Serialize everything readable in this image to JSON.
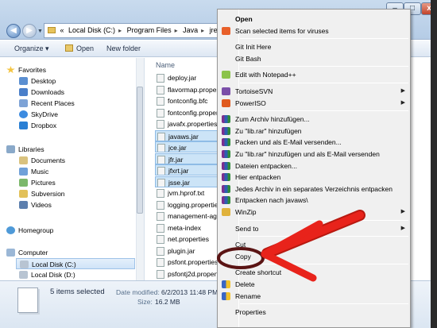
{
  "address": {
    "path": [
      "«",
      "Local Disk (C:)",
      "Program Files",
      "Java",
      "jre7"
    ]
  },
  "window_buttons": {
    "minimize": "–",
    "maximize": "□",
    "close": "x"
  },
  "toolbar": {
    "organize": "Organize ▾",
    "open": "Open",
    "new_folder": "New folder"
  },
  "navpane": {
    "favorites_header": "Favorites",
    "favorites": [
      "Desktop",
      "Downloads",
      "Recent Places",
      "SkyDrive",
      "Dropbox"
    ],
    "libraries_header": "Libraries",
    "libraries": [
      "Documents",
      "Music",
      "Pictures",
      "Subversion",
      "Videos"
    ],
    "homegroup": "Homegroup",
    "computer_header": "Computer",
    "drives": [
      "Local Disk (C:)",
      "Local Disk (D:)"
    ]
  },
  "filelist": {
    "column_name": "Name",
    "files": [
      {
        "name": "deploy.jar",
        "selected": false
      },
      {
        "name": "flavormap.properties",
        "selected": false
      },
      {
        "name": "fontconfig.bfc",
        "selected": false
      },
      {
        "name": "fontconfig.properties.src",
        "selected": false
      },
      {
        "name": "javafx.properties",
        "selected": false
      },
      {
        "name": "javaws.jar",
        "selected": true
      },
      {
        "name": "jce.jar",
        "selected": true
      },
      {
        "name": "jfr.jar",
        "selected": true
      },
      {
        "name": "jfxrt.jar",
        "selected": true
      },
      {
        "name": "jsse.jar",
        "selected": true
      },
      {
        "name": "jvm.hprof.txt",
        "selected": false
      },
      {
        "name": "logging.properties",
        "selected": false
      },
      {
        "name": "management-agent.jar",
        "selected": false
      },
      {
        "name": "meta-index",
        "selected": false
      },
      {
        "name": "net.properties",
        "selected": false
      },
      {
        "name": "plugin.jar",
        "selected": false
      },
      {
        "name": "psfont.properties.ja",
        "selected": false
      },
      {
        "name": "psfontj2d.properties",
        "selected": false
      }
    ]
  },
  "details": {
    "count": "5 items selected",
    "modified_label": "Date modified:",
    "modified_value": "6/2/2013 11:48 PM",
    "size_label": "Size:",
    "size_value": "16.2 MB"
  },
  "context_menu": {
    "items": [
      {
        "label": "Open",
        "bold": true,
        "icon": "",
        "submenu": false
      },
      {
        "label": "Scan selected items for viruses",
        "icon": "scan-icon",
        "submenu": false
      },
      {
        "sep": true
      },
      {
        "label": "Git Init Here",
        "icon": "",
        "submenu": false
      },
      {
        "label": "Git Bash",
        "icon": "",
        "submenu": false
      },
      {
        "sep": true
      },
      {
        "label": "Edit with Notepad++",
        "icon": "notepad-icon",
        "submenu": false
      },
      {
        "sep": true
      },
      {
        "label": "TortoiseSVN",
        "icon": "svn-icon",
        "submenu": true
      },
      {
        "label": "PowerISO",
        "icon": "poweriso-icon",
        "submenu": true
      },
      {
        "sep": true
      },
      {
        "label": "Zum Archiv hinzufügen...",
        "icon": "winrar-icon",
        "submenu": false
      },
      {
        "label": "Zu \"lib.rar\" hinzufügen",
        "icon": "winrar-icon",
        "submenu": false
      },
      {
        "label": "Packen und als E-Mail versenden...",
        "icon": "winrar-icon",
        "submenu": false
      },
      {
        "label": "Zu \"lib.rar\" hinzufügen und als E-Mail versenden",
        "icon": "winrar-icon",
        "submenu": false
      },
      {
        "label": "Dateien entpacken...",
        "icon": "winrar-icon",
        "submenu": false
      },
      {
        "label": "Hier entpacken",
        "icon": "winrar-icon",
        "submenu": false
      },
      {
        "label": "Jedes Archiv in ein separates Verzeichnis entpacken",
        "icon": "winrar-icon",
        "submenu": false
      },
      {
        "label": "Entpacken nach javaws\\",
        "icon": "winrar-icon",
        "submenu": false
      },
      {
        "label": "WinZip",
        "icon": "winzip-icon",
        "submenu": true
      },
      {
        "sep": true
      },
      {
        "label": "Send to",
        "icon": "",
        "submenu": true
      },
      {
        "sep": true
      },
      {
        "label": "Cut",
        "icon": "",
        "submenu": false
      },
      {
        "label": "Copy",
        "icon": "",
        "submenu": false,
        "highlight": true
      },
      {
        "sep": true
      },
      {
        "label": "Create shortcut",
        "icon": "",
        "submenu": false
      },
      {
        "label": "Delete",
        "icon": "shield-icon",
        "submenu": false
      },
      {
        "label": "Rename",
        "icon": "shield-icon",
        "submenu": false
      },
      {
        "sep": true
      },
      {
        "label": "Properties",
        "icon": "",
        "submenu": false
      }
    ]
  },
  "colors": {
    "annotation": "#e8231b",
    "copy_ring": "#5a1414",
    "selection": "#cce4f7"
  }
}
